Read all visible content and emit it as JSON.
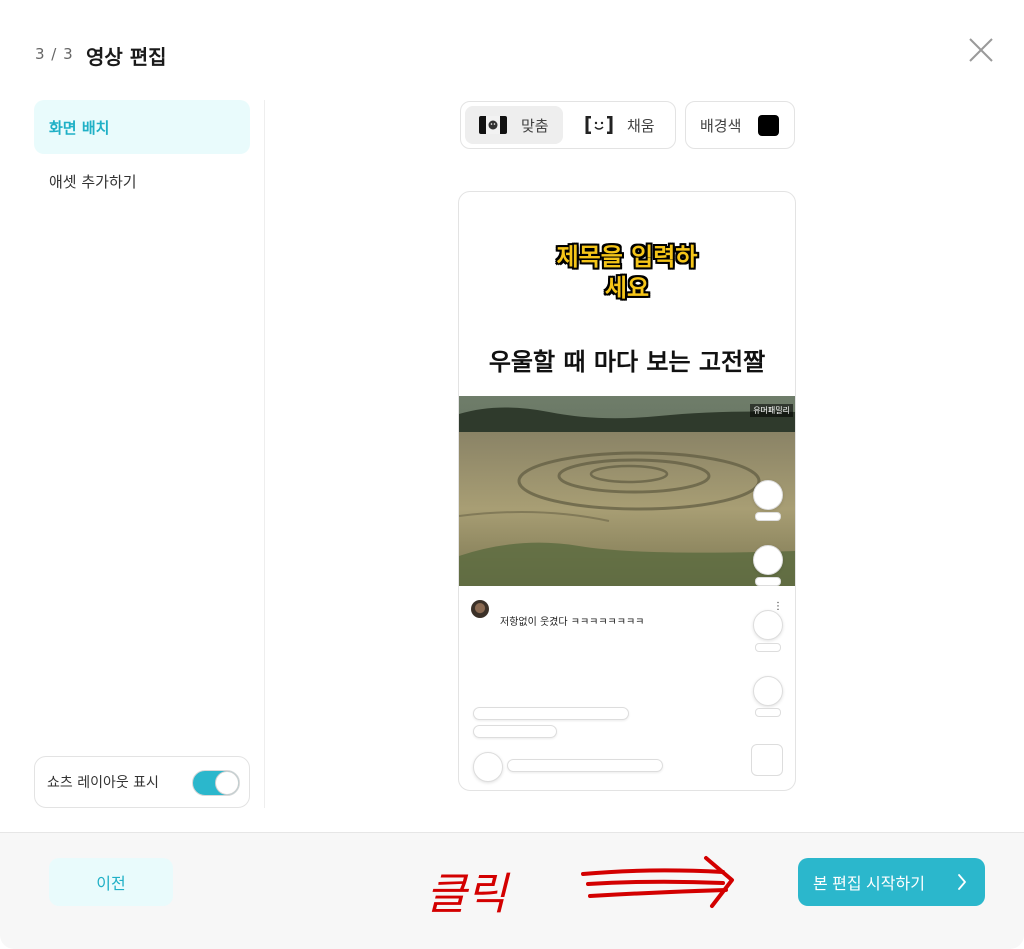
{
  "header": {
    "step": "3 / 3",
    "title": "영상 편집"
  },
  "sidebar": {
    "items": [
      {
        "label": "화면 배치",
        "active": true
      },
      {
        "label": "애셋 추가하기",
        "active": false
      }
    ],
    "toggle": {
      "label": "쇼츠 레이아웃 표시",
      "on": true
    }
  },
  "toolbar": {
    "fit_label": "맞춤",
    "fill_label": "채움",
    "bg_label": "배경색",
    "bg_color": "#000000"
  },
  "preview": {
    "title": "제목을 입력하\n세요",
    "subtitle": "우울할 때 마다 보는 고전짤",
    "watermark": "유머패밀리",
    "comment": "저항없이 웃겼다 ㅋㅋㅋㅋㅋㅋㅋㅋ",
    "more": "⋮"
  },
  "footer": {
    "prev_label": "이전",
    "start_label": "본 편집 시작하기",
    "annotation": "클릭"
  },
  "colors": {
    "accent": "#2bb7cc",
    "accent_light": "#e9fbfc",
    "annotation": "#d30000"
  }
}
